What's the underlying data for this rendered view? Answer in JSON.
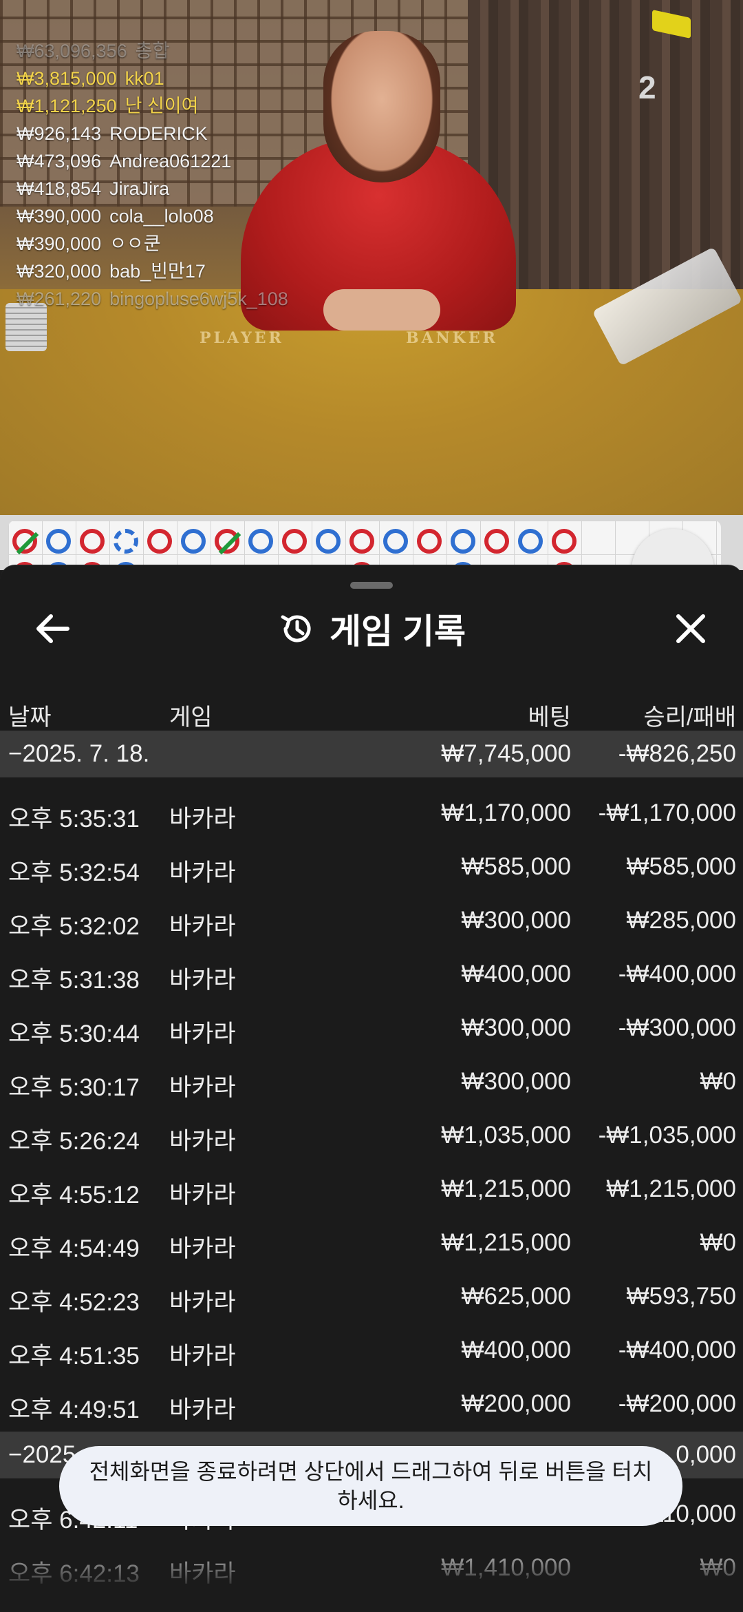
{
  "video": {
    "timer": "2",
    "winners": [
      {
        "amount": "₩63,096,356",
        "name": "총합"
      },
      {
        "amount": "₩3,815,000",
        "name": "kk01"
      },
      {
        "amount": "₩1,121,250",
        "name": "난 신이여"
      },
      {
        "amount": "₩926,143",
        "name": "RODERICK"
      },
      {
        "amount": "₩473,096",
        "name": "Andrea061221"
      },
      {
        "amount": "₩418,854",
        "name": "JiraJira"
      },
      {
        "amount": "₩390,000",
        "name": "cola__lolo08"
      },
      {
        "amount": "₩390,000",
        "name": "ㅇㅇ쿤"
      },
      {
        "amount": "₩320,000",
        "name": "bab_빈만17"
      },
      {
        "amount": "₩261,220",
        "name": "bingopluse6wj5k_108"
      }
    ],
    "table_labels": {
      "player": "PLAYER",
      "banker": "BANKER"
    }
  },
  "road": {
    "beads_row1": [
      "red-tie",
      "blue",
      "red",
      "blue-dash",
      "red",
      "blue",
      "red-tie",
      "blue",
      "red",
      "blue",
      "red",
      "blue",
      "red",
      "blue",
      "red",
      "blue",
      "red"
    ],
    "beads_row2": [
      "red",
      "blue",
      "red",
      "blue",
      "",
      "",
      "",
      "",
      "",
      "",
      "red",
      "",
      "",
      "blue",
      "",
      "",
      "red"
    ]
  },
  "sheet": {
    "title": "게임 기록",
    "columns": {
      "date": "날짜",
      "game": "게임",
      "bet": "베팅",
      "result": "승리/패배"
    },
    "groups": [
      {
        "date": "−2025. 7. 18.",
        "total_bet": "₩7,745,000",
        "total_result": "-₩826,250",
        "records": [
          {
            "time": "오후 5:35:31",
            "game": "바카라",
            "bet": "₩1,170,000",
            "result": "-₩1,170,000"
          },
          {
            "time": "오후 5:32:54",
            "game": "바카라",
            "bet": "₩585,000",
            "result": "₩585,000"
          },
          {
            "time": "오후 5:32:02",
            "game": "바카라",
            "bet": "₩300,000",
            "result": "₩285,000"
          },
          {
            "time": "오후 5:31:38",
            "game": "바카라",
            "bet": "₩400,000",
            "result": "-₩400,000"
          },
          {
            "time": "오후 5:30:44",
            "game": "바카라",
            "bet": "₩300,000",
            "result": "-₩300,000"
          },
          {
            "time": "오후 5:30:17",
            "game": "바카라",
            "bet": "₩300,000",
            "result": "₩0"
          },
          {
            "time": "오후 5:26:24",
            "game": "바카라",
            "bet": "₩1,035,000",
            "result": "-₩1,035,000"
          },
          {
            "time": "오후 4:55:12",
            "game": "바카라",
            "bet": "₩1,215,000",
            "result": "₩1,215,000"
          },
          {
            "time": "오후 4:54:49",
            "game": "바카라",
            "bet": "₩1,215,000",
            "result": "₩0"
          },
          {
            "time": "오후 4:52:23",
            "game": "바카라",
            "bet": "₩625,000",
            "result": "₩593,750"
          },
          {
            "time": "오후 4:51:35",
            "game": "바카라",
            "bet": "₩400,000",
            "result": "-₩400,000"
          },
          {
            "time": "오후 4:49:51",
            "game": "바카라",
            "bet": "₩200,000",
            "result": "-₩200,000"
          }
        ]
      },
      {
        "date": "−2025",
        "total_bet": "",
        "total_result": "0,000",
        "records": [
          {
            "time": "오후 6:42:11",
            "game": "바카라",
            "bet": "₩1,110,000",
            "result": "₩1,110,000"
          },
          {
            "time": "오후 6:42:13",
            "game": "바카라",
            "bet": "₩1,410,000",
            "result": "₩0"
          }
        ]
      }
    ]
  },
  "toast": {
    "message": "전체화면을 종료하려면 상단에서 드래그하여 뒤로 버튼을 터치하세요."
  },
  "colors": {
    "sheet_bg": "#1b1b1b",
    "date_row_bg": "#3a3a3a",
    "winner_gold": "#f2d34a",
    "bead_red": "#d3262f",
    "bead_blue": "#2f6fd1",
    "tie_green": "#1f9a3a"
  }
}
